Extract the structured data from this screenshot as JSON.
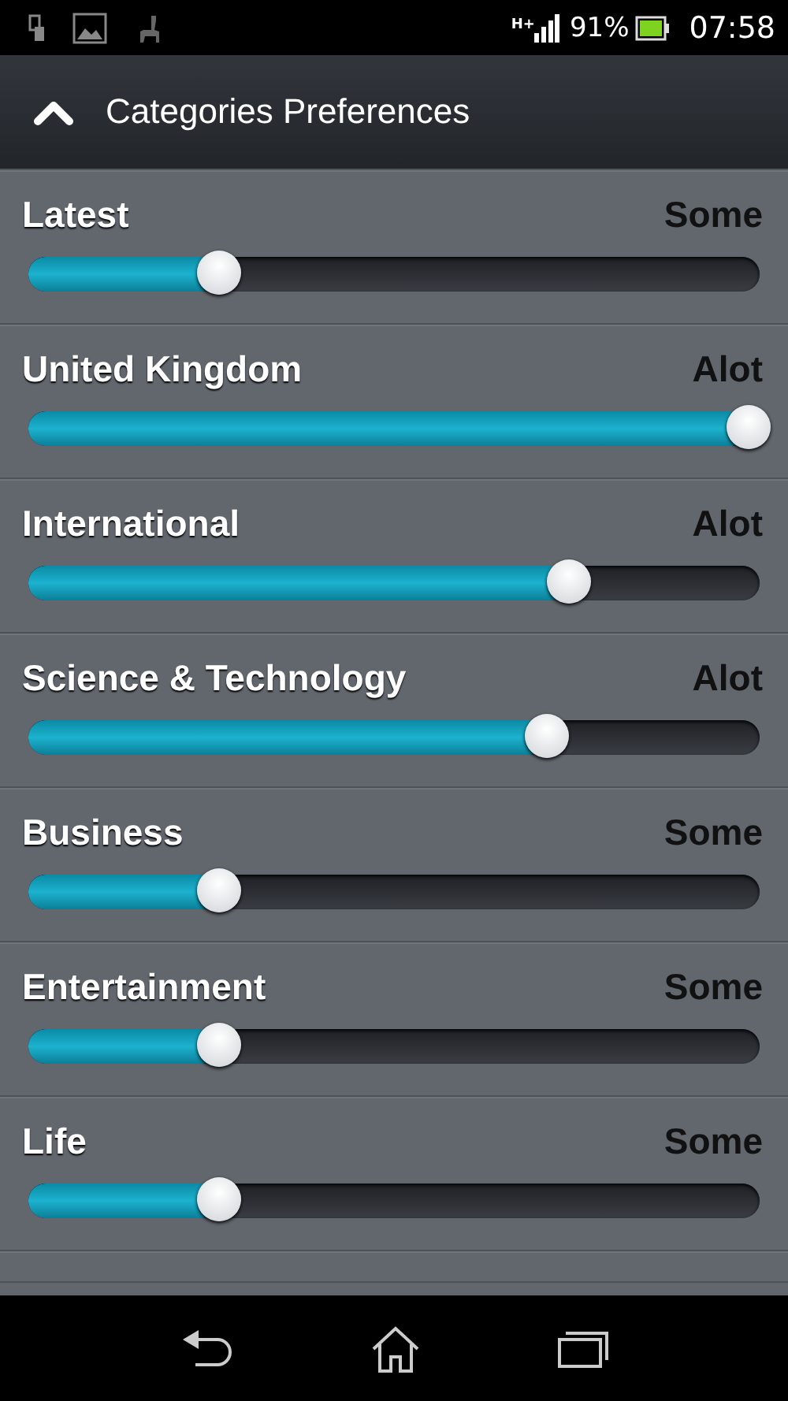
{
  "status_bar": {
    "network": "H+",
    "battery": "91%",
    "time": "07:58"
  },
  "header": {
    "title": "Categories Preferences"
  },
  "categories": [
    {
      "name": "Latest",
      "reading": "Some",
      "level": 0.26
    },
    {
      "name": "United Kingdom",
      "reading": "Alot",
      "level": 0.985
    },
    {
      "name": "International",
      "reading": "Alot",
      "level": 0.74
    },
    {
      "name": "Science & Technology",
      "reading": "Alot",
      "level": 0.71
    },
    {
      "name": "Business",
      "reading": "Some",
      "level": 0.26
    },
    {
      "name": "Entertainment",
      "reading": "Some",
      "level": 0.26
    },
    {
      "name": "Life",
      "reading": "Some",
      "level": 0.26
    }
  ]
}
